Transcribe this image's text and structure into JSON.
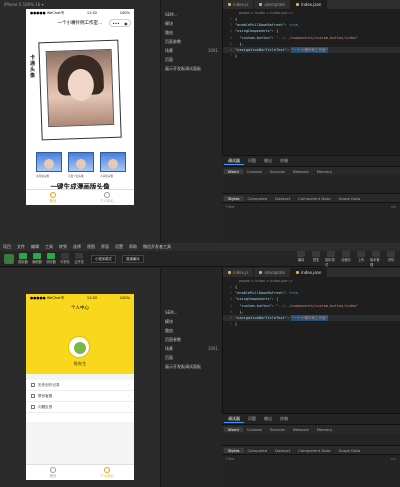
{
  "top": {
    "sim_label": "iPhone 5 100% 16 ▾",
    "status": {
      "carrier": "●●●●● WeChat令",
      "time": "11:52",
      "battery": "100%"
    },
    "nav_title": "一个小嘴伶俐工作室…",
    "capsule": [
      "•••",
      "◉"
    ],
    "poster_side_text": "卡\n通\n头\n像",
    "thumb_labels": [
      "古风女头像",
      "可爱少女头像",
      "小清新头像"
    ],
    "slogan": "一键生成漫画版头像",
    "tabs": [
      "首页",
      "个人中心"
    ],
    "explorer": {
      "header": "SEM...",
      "rows": [
        {
          "k": "模块",
          "v": ""
        },
        {
          "k": "路由",
          "v": ""
        },
        {
          "k": "页面参数",
          "v": ""
        },
        {
          "k": "场景",
          "v": "1001"
        },
        {
          "k": "页面",
          "v": ""
        }
      ],
      "extra": "展示开发板调试面板"
    },
    "editor": {
      "tabs": [
        "index.js",
        "utemplate",
        "index.json"
      ],
      "crumb": "pages > index > index.json >",
      "lines": [
        {
          "n": "1",
          "t": "{"
        },
        {
          "n": "2",
          "k": "\"enablePullDownRefresh\"",
          "v": "true,"
        },
        {
          "n": "3",
          "k": "\"usingComponents\"",
          "v": "{"
        },
        {
          "n": "4",
          "k": "  \"custom-button\"",
          "s": "\"../../components/custom-button/index\""
        },
        {
          "n": "5",
          "t": "  },"
        },
        {
          "n": "6",
          "k": "\"navigationBarTitleText\"",
          "s": "\"一个小嘴伶俐工作室\""
        },
        {
          "n": "7",
          "t": "}"
        }
      ]
    },
    "devtools": {
      "tabs": [
        "调试器",
        "问题",
        "输出",
        "终端"
      ],
      "panels": [
        "Wxml",
        "Console",
        "Sources",
        "Network",
        "Memory"
      ],
      "sub": [
        "Styles",
        "Computed",
        "Dataset",
        "Component Data",
        "Scope Data"
      ],
      "filter": "Filter",
      "filter_right": ".cls"
    }
  },
  "bottom": {
    "menubar": [
      "项目",
      "文件",
      "编辑",
      "工具",
      "转到",
      "选择",
      "视图",
      "界面",
      "设置",
      "帮助",
      "微信开发者工具"
    ],
    "toolbar_btns": [
      "模拟器",
      "编辑器",
      "调试器",
      "可视化",
      "云开发"
    ],
    "tb_select": "小程序模式",
    "tb_select2": "普通编译",
    "tb_right": [
      "编译",
      "预览",
      "真机调试",
      "清缓存",
      "上传",
      "版本管理",
      "详情"
    ],
    "nav_title": "个人中心",
    "status": {
      "carrier": "●●●●● WeChat令",
      "time": "11:52",
      "battery": "100%"
    },
    "username": "陈先生",
    "menu": [
      "历史创作记录",
      "联系客服",
      "问题反馈"
    ],
    "tabs": [
      "首页",
      "个人中心"
    ],
    "explorer": {
      "header": "SEM...",
      "rows": [
        {
          "k": "模块",
          "v": ""
        },
        {
          "k": "路由",
          "v": ""
        },
        {
          "k": "页面参数",
          "v": ""
        },
        {
          "k": "场景",
          "v": "1001"
        },
        {
          "k": "页面",
          "v": ""
        }
      ],
      "extra": "展示开发板调试面板"
    },
    "editor": {
      "tabs": [
        "index.js",
        "utemplate",
        "index.json"
      ],
      "crumb": "pages > index > index.json >",
      "lines": [
        {
          "n": "1",
          "t": "{"
        },
        {
          "n": "2",
          "k": "\"enablePullDownRefresh\"",
          "v": "true,"
        },
        {
          "n": "3",
          "k": "\"usingComponents\"",
          "v": "{"
        },
        {
          "n": "4",
          "k": "  \"custom-button\"",
          "s": "\"../../components/custom-button/index\""
        },
        {
          "n": "5",
          "t": "  },"
        },
        {
          "n": "6",
          "k": "\"navigationBarTitleText\"",
          "s": "\"一个小嘴伶俐工作室\""
        },
        {
          "n": "7",
          "t": "}"
        }
      ]
    },
    "devtools": {
      "tabs": [
        "调试器",
        "问题",
        "输出",
        "终端"
      ],
      "panels": [
        "Wxml",
        "Console",
        "Sources",
        "Network",
        "Memory"
      ],
      "sub": [
        "Styles",
        "Computed",
        "Dataset",
        "Component Data",
        "Scope Data"
      ],
      "filter": "Filter",
      "filter_right": ".cls"
    }
  },
  "colors": {
    "accent_yellow": "#f9d71c",
    "tab_active": "#f39c12",
    "selection": "#264f78"
  }
}
